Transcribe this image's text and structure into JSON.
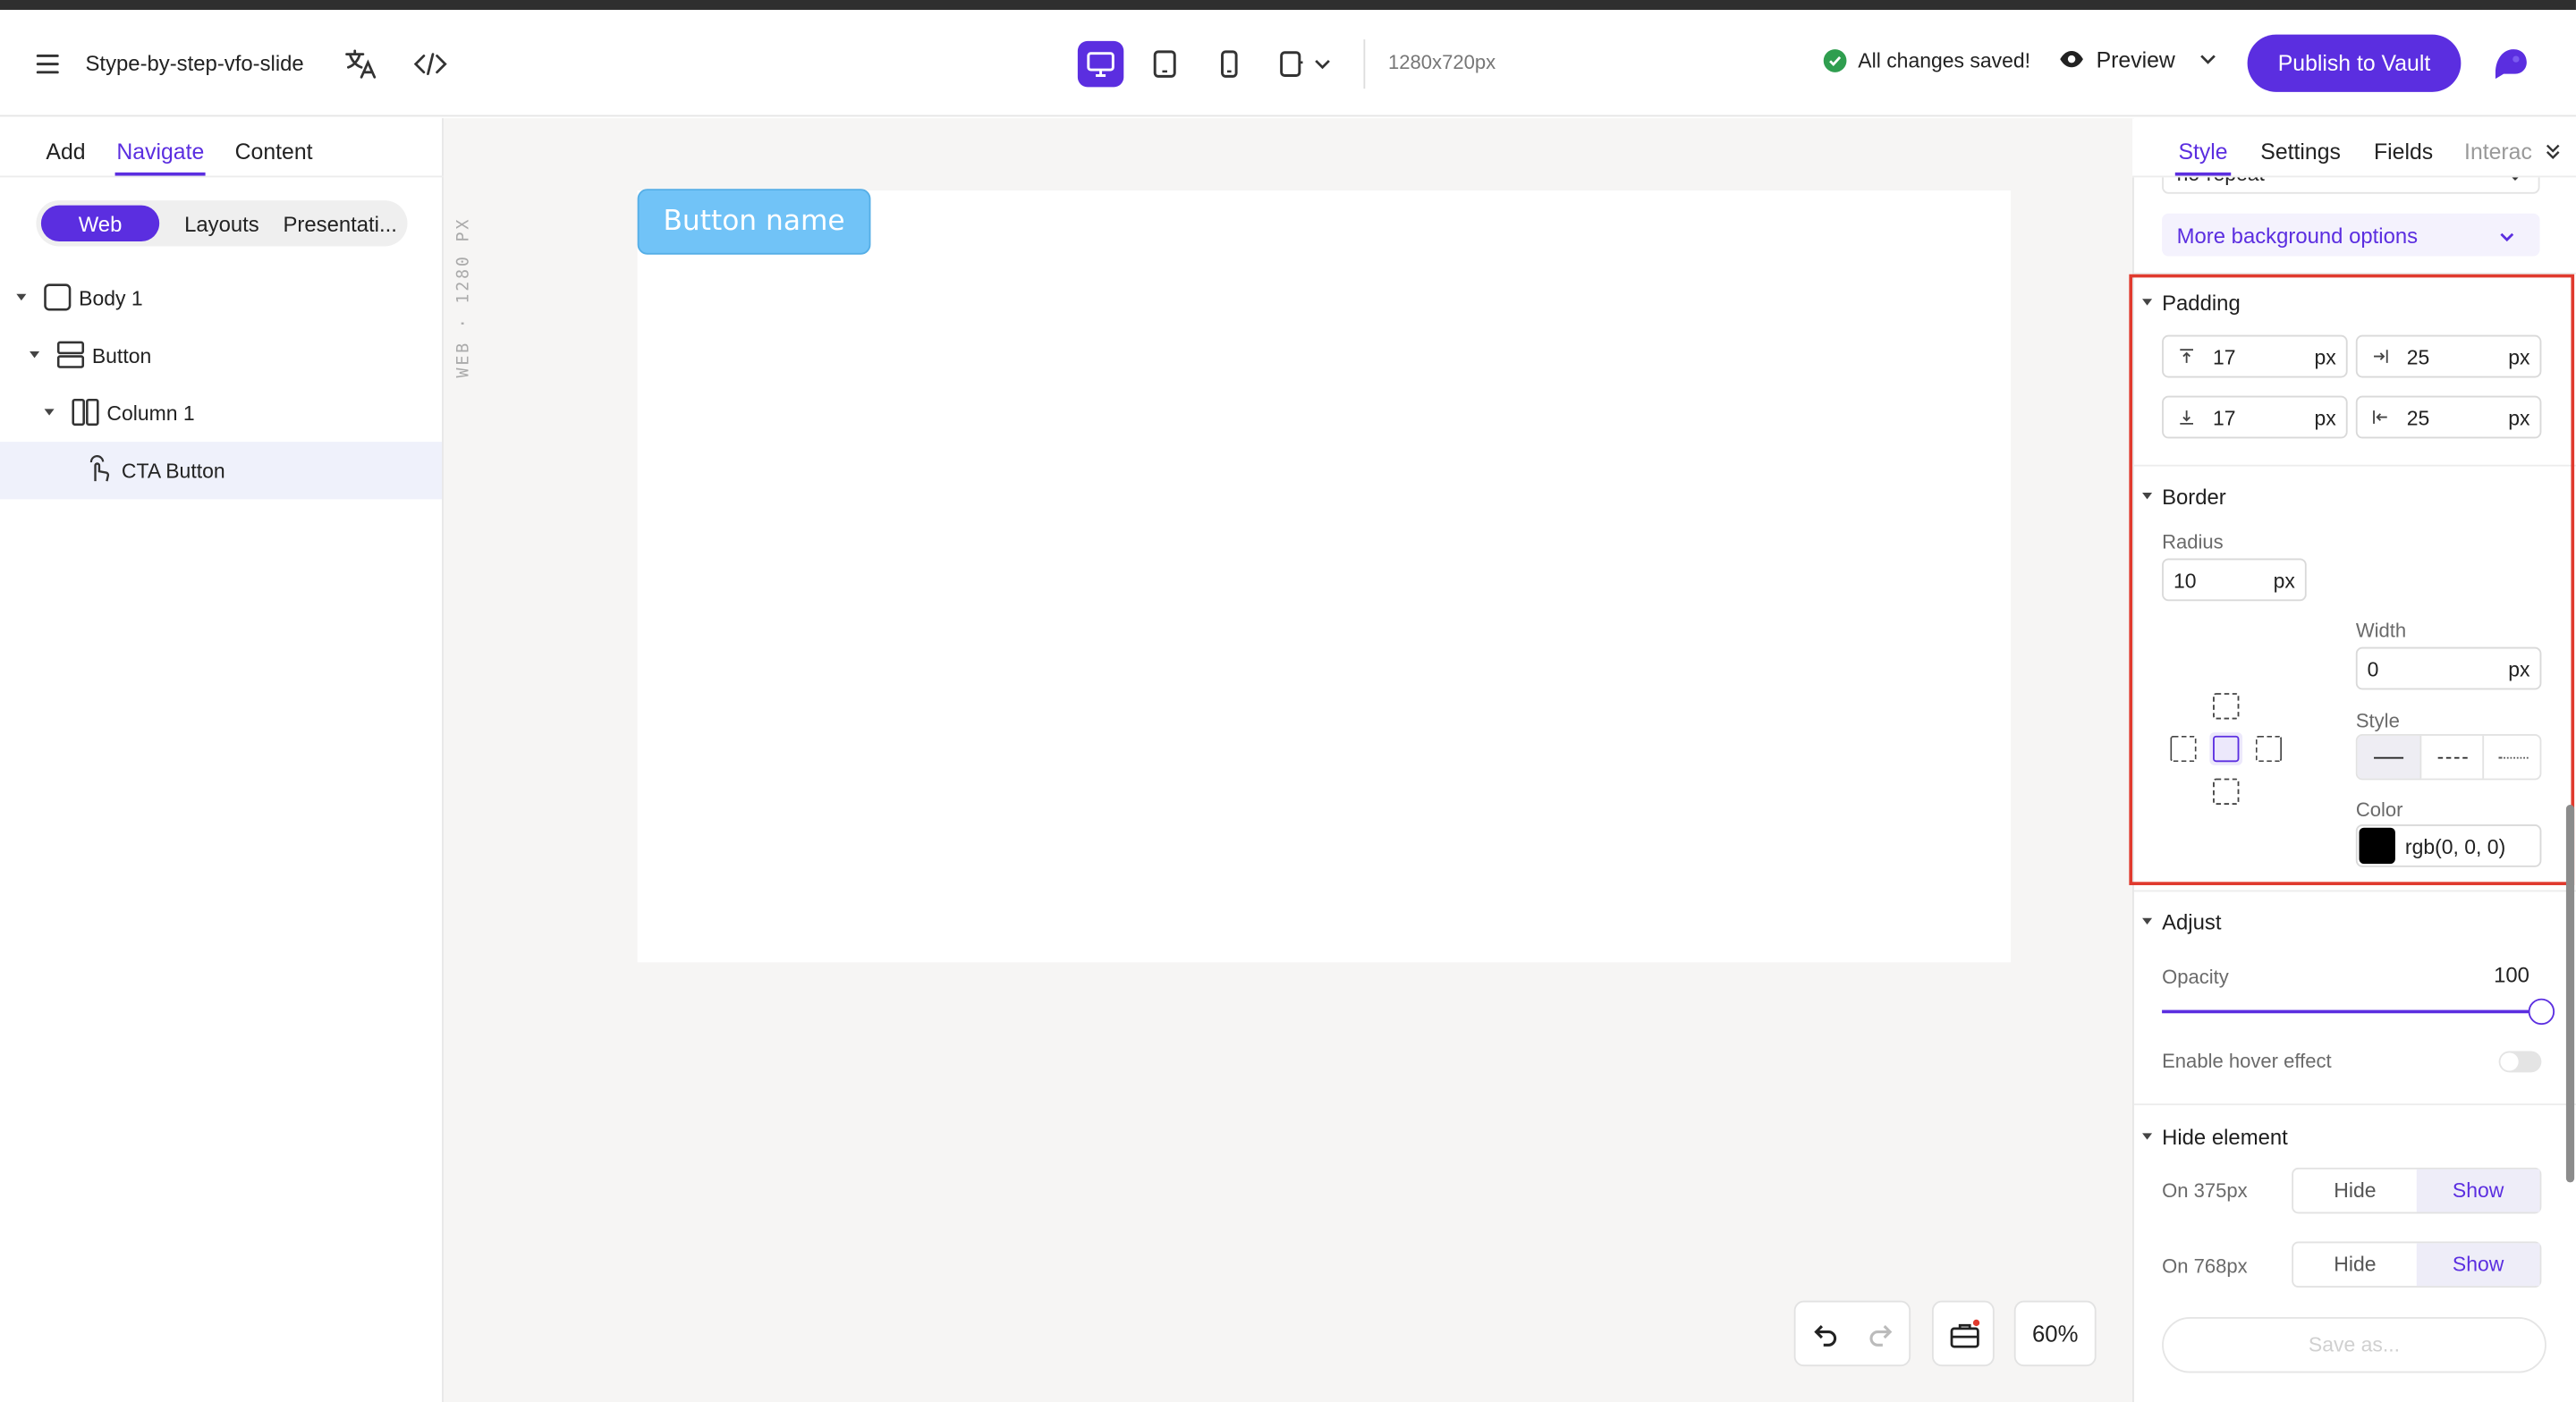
{
  "app": {
    "file_name": "Stype-by-step-vfo-slide",
    "canvas_size": "1280x720px",
    "save_status": "All changes saved!",
    "preview_label": "Preview",
    "publish_label": "Publish to Vault",
    "accent_color": "#5b2ee0"
  },
  "left_panel": {
    "tabs": [
      "Add",
      "Navigate",
      "Content"
    ],
    "active_tab": "Navigate",
    "segments": [
      "Web",
      "Layouts",
      "Presentati..."
    ],
    "active_segment": "Web",
    "tree": [
      {
        "label": "Body 1",
        "icon": "square-icon"
      },
      {
        "label": "Button",
        "icon": "rows-icon"
      },
      {
        "label": "Column 1",
        "icon": "columns-icon"
      },
      {
        "label": "CTA Button",
        "icon": "pointer-icon",
        "selected": true
      }
    ]
  },
  "canvas": {
    "ruler_label": "WEB · 1280 PX",
    "button_text": "Button name",
    "zoom": "60%"
  },
  "right_panel": {
    "tabs": [
      "Style",
      "Settings",
      "Fields",
      "Interac"
    ],
    "active_tab": "Style",
    "background_repeat": "no-repeat",
    "more_background": "More background options",
    "padding": {
      "title": "Padding",
      "top": "17",
      "right": "25",
      "bottom": "17",
      "left": "25",
      "unit": "px"
    },
    "border": {
      "title": "Border",
      "radius_label": "Radius",
      "radius": "10",
      "width_label": "Width",
      "width": "0",
      "style_label": "Style",
      "color_label": "Color",
      "color_value": "rgb(0, 0, 0)",
      "unit": "px"
    },
    "adjust": {
      "title": "Adjust",
      "opacity_label": "Opacity",
      "opacity": "100",
      "hover_label": "Enable hover effect"
    },
    "hide": {
      "title": "Hide element",
      "rows": [
        {
          "label": "On 375px",
          "hide": "Hide",
          "show": "Show"
        },
        {
          "label": "On 768px",
          "hide": "Hide",
          "show": "Show"
        }
      ]
    },
    "save_as": "Save as..."
  }
}
